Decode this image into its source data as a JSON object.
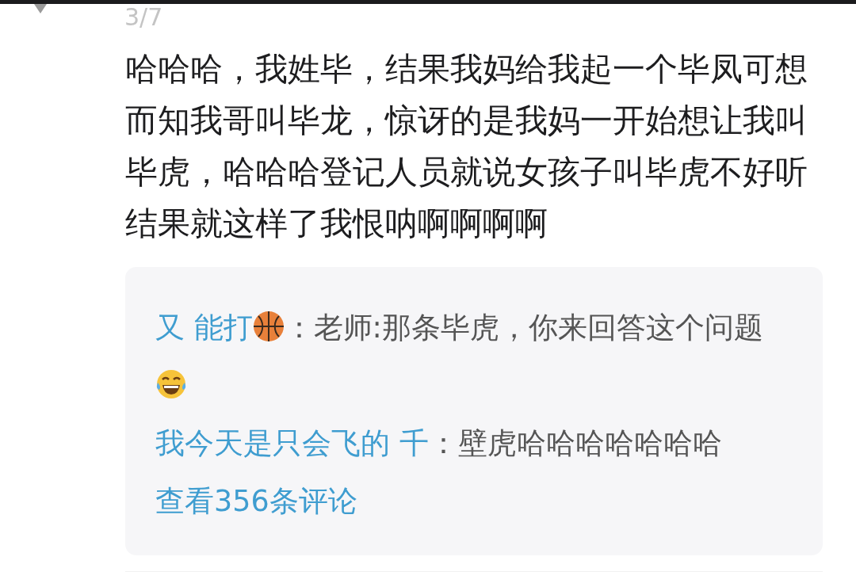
{
  "page_counter": "3/7",
  "comment": {
    "text": "哈哈哈，我姓毕，结果我妈给我起一个毕凤可想而知我哥叫毕龙，惊讶的是我妈一开始想让我叫毕虎，哈哈哈登记人员就说女孩子叫毕虎不好听结果就这样了我恨呐啊啊啊啊"
  },
  "replies": [
    {
      "author": "又  能打",
      "text": "：老师:那条毕虎，你来回答这个问题"
    },
    {
      "author": "我今天是只会飞的 千",
      "text": "：壁虎哈哈哈哈哈哈哈"
    }
  ],
  "view_more": "查看356条评论"
}
